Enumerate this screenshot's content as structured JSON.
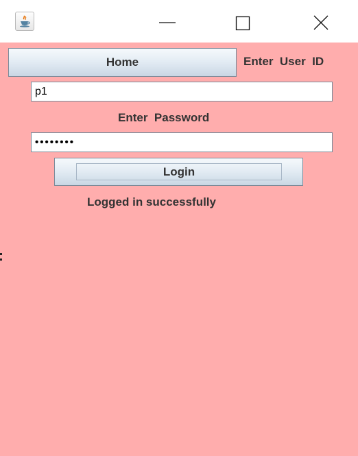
{
  "titlebar": {
    "app_icon": "java-coffee-cup-icon",
    "controls": {
      "minimize_icon": "minimize-icon",
      "maximize_icon": "maximize-icon",
      "close_icon": "close-icon"
    }
  },
  "form": {
    "home_button": "Home",
    "user_id_label": "Enter  User  ID",
    "user_id_value": "p1",
    "password_label": "Enter  Password",
    "password_value": "pass1234",
    "login_button": "Login",
    "status_message": "Logged in successfully"
  },
  "colors": {
    "background": "#ffadad",
    "button_gradient_top": "#f6f9fc",
    "button_gradient_bottom": "#c9d7e4",
    "label_text": "#333333"
  }
}
